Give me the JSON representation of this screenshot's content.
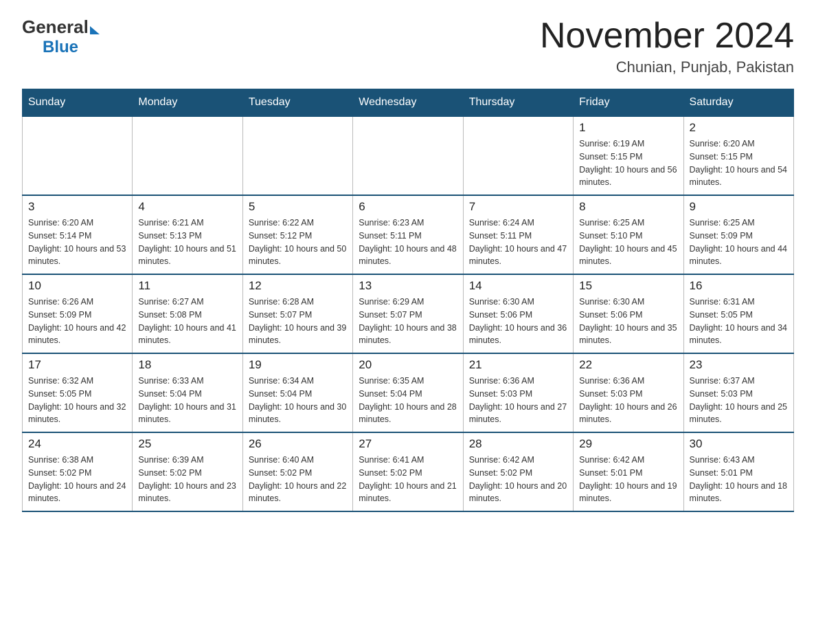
{
  "header": {
    "logo_general": "General",
    "logo_blue": "Blue",
    "month_title": "November 2024",
    "location": "Chunian, Punjab, Pakistan"
  },
  "days_of_week": [
    "Sunday",
    "Monday",
    "Tuesday",
    "Wednesday",
    "Thursday",
    "Friday",
    "Saturday"
  ],
  "weeks": [
    [
      {
        "day": "",
        "sunrise": "",
        "sunset": "",
        "daylight": "",
        "empty": true
      },
      {
        "day": "",
        "sunrise": "",
        "sunset": "",
        "daylight": "",
        "empty": true
      },
      {
        "day": "",
        "sunrise": "",
        "sunset": "",
        "daylight": "",
        "empty": true
      },
      {
        "day": "",
        "sunrise": "",
        "sunset": "",
        "daylight": "",
        "empty": true
      },
      {
        "day": "",
        "sunrise": "",
        "sunset": "",
        "daylight": "",
        "empty": true
      },
      {
        "day": "1",
        "sunrise": "Sunrise: 6:19 AM",
        "sunset": "Sunset: 5:15 PM",
        "daylight": "Daylight: 10 hours and 56 minutes.",
        "empty": false
      },
      {
        "day": "2",
        "sunrise": "Sunrise: 6:20 AM",
        "sunset": "Sunset: 5:15 PM",
        "daylight": "Daylight: 10 hours and 54 minutes.",
        "empty": false
      }
    ],
    [
      {
        "day": "3",
        "sunrise": "Sunrise: 6:20 AM",
        "sunset": "Sunset: 5:14 PM",
        "daylight": "Daylight: 10 hours and 53 minutes.",
        "empty": false
      },
      {
        "day": "4",
        "sunrise": "Sunrise: 6:21 AM",
        "sunset": "Sunset: 5:13 PM",
        "daylight": "Daylight: 10 hours and 51 minutes.",
        "empty": false
      },
      {
        "day": "5",
        "sunrise": "Sunrise: 6:22 AM",
        "sunset": "Sunset: 5:12 PM",
        "daylight": "Daylight: 10 hours and 50 minutes.",
        "empty": false
      },
      {
        "day": "6",
        "sunrise": "Sunrise: 6:23 AM",
        "sunset": "Sunset: 5:11 PM",
        "daylight": "Daylight: 10 hours and 48 minutes.",
        "empty": false
      },
      {
        "day": "7",
        "sunrise": "Sunrise: 6:24 AM",
        "sunset": "Sunset: 5:11 PM",
        "daylight": "Daylight: 10 hours and 47 minutes.",
        "empty": false
      },
      {
        "day": "8",
        "sunrise": "Sunrise: 6:25 AM",
        "sunset": "Sunset: 5:10 PM",
        "daylight": "Daylight: 10 hours and 45 minutes.",
        "empty": false
      },
      {
        "day": "9",
        "sunrise": "Sunrise: 6:25 AM",
        "sunset": "Sunset: 5:09 PM",
        "daylight": "Daylight: 10 hours and 44 minutes.",
        "empty": false
      }
    ],
    [
      {
        "day": "10",
        "sunrise": "Sunrise: 6:26 AM",
        "sunset": "Sunset: 5:09 PM",
        "daylight": "Daylight: 10 hours and 42 minutes.",
        "empty": false
      },
      {
        "day": "11",
        "sunrise": "Sunrise: 6:27 AM",
        "sunset": "Sunset: 5:08 PM",
        "daylight": "Daylight: 10 hours and 41 minutes.",
        "empty": false
      },
      {
        "day": "12",
        "sunrise": "Sunrise: 6:28 AM",
        "sunset": "Sunset: 5:07 PM",
        "daylight": "Daylight: 10 hours and 39 minutes.",
        "empty": false
      },
      {
        "day": "13",
        "sunrise": "Sunrise: 6:29 AM",
        "sunset": "Sunset: 5:07 PM",
        "daylight": "Daylight: 10 hours and 38 minutes.",
        "empty": false
      },
      {
        "day": "14",
        "sunrise": "Sunrise: 6:30 AM",
        "sunset": "Sunset: 5:06 PM",
        "daylight": "Daylight: 10 hours and 36 minutes.",
        "empty": false
      },
      {
        "day": "15",
        "sunrise": "Sunrise: 6:30 AM",
        "sunset": "Sunset: 5:06 PM",
        "daylight": "Daylight: 10 hours and 35 minutes.",
        "empty": false
      },
      {
        "day": "16",
        "sunrise": "Sunrise: 6:31 AM",
        "sunset": "Sunset: 5:05 PM",
        "daylight": "Daylight: 10 hours and 34 minutes.",
        "empty": false
      }
    ],
    [
      {
        "day": "17",
        "sunrise": "Sunrise: 6:32 AM",
        "sunset": "Sunset: 5:05 PM",
        "daylight": "Daylight: 10 hours and 32 minutes.",
        "empty": false
      },
      {
        "day": "18",
        "sunrise": "Sunrise: 6:33 AM",
        "sunset": "Sunset: 5:04 PM",
        "daylight": "Daylight: 10 hours and 31 minutes.",
        "empty": false
      },
      {
        "day": "19",
        "sunrise": "Sunrise: 6:34 AM",
        "sunset": "Sunset: 5:04 PM",
        "daylight": "Daylight: 10 hours and 30 minutes.",
        "empty": false
      },
      {
        "day": "20",
        "sunrise": "Sunrise: 6:35 AM",
        "sunset": "Sunset: 5:04 PM",
        "daylight": "Daylight: 10 hours and 28 minutes.",
        "empty": false
      },
      {
        "day": "21",
        "sunrise": "Sunrise: 6:36 AM",
        "sunset": "Sunset: 5:03 PM",
        "daylight": "Daylight: 10 hours and 27 minutes.",
        "empty": false
      },
      {
        "day": "22",
        "sunrise": "Sunrise: 6:36 AM",
        "sunset": "Sunset: 5:03 PM",
        "daylight": "Daylight: 10 hours and 26 minutes.",
        "empty": false
      },
      {
        "day": "23",
        "sunrise": "Sunrise: 6:37 AM",
        "sunset": "Sunset: 5:03 PM",
        "daylight": "Daylight: 10 hours and 25 minutes.",
        "empty": false
      }
    ],
    [
      {
        "day": "24",
        "sunrise": "Sunrise: 6:38 AM",
        "sunset": "Sunset: 5:02 PM",
        "daylight": "Daylight: 10 hours and 24 minutes.",
        "empty": false
      },
      {
        "day": "25",
        "sunrise": "Sunrise: 6:39 AM",
        "sunset": "Sunset: 5:02 PM",
        "daylight": "Daylight: 10 hours and 23 minutes.",
        "empty": false
      },
      {
        "day": "26",
        "sunrise": "Sunrise: 6:40 AM",
        "sunset": "Sunset: 5:02 PM",
        "daylight": "Daylight: 10 hours and 22 minutes.",
        "empty": false
      },
      {
        "day": "27",
        "sunrise": "Sunrise: 6:41 AM",
        "sunset": "Sunset: 5:02 PM",
        "daylight": "Daylight: 10 hours and 21 minutes.",
        "empty": false
      },
      {
        "day": "28",
        "sunrise": "Sunrise: 6:42 AM",
        "sunset": "Sunset: 5:02 PM",
        "daylight": "Daylight: 10 hours and 20 minutes.",
        "empty": false
      },
      {
        "day": "29",
        "sunrise": "Sunrise: 6:42 AM",
        "sunset": "Sunset: 5:01 PM",
        "daylight": "Daylight: 10 hours and 19 minutes.",
        "empty": false
      },
      {
        "day": "30",
        "sunrise": "Sunrise: 6:43 AM",
        "sunset": "Sunset: 5:01 PM",
        "daylight": "Daylight: 10 hours and 18 minutes.",
        "empty": false
      }
    ]
  ]
}
